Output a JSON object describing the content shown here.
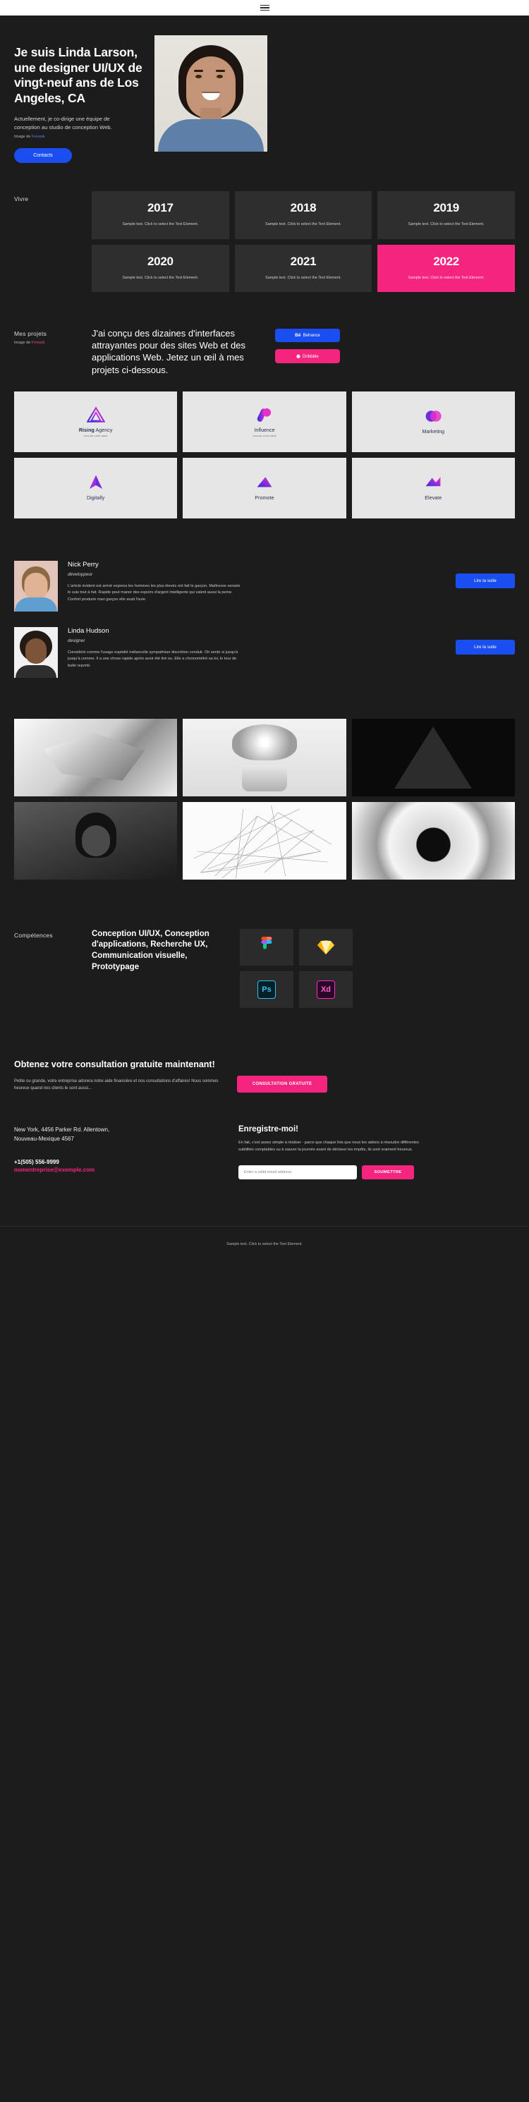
{
  "topbar": {
    "menu_icon": "hamburger-menu-icon"
  },
  "hero": {
    "title": "Je suis Linda Larson, une designer UI/UX de vingt-neuf ans de Los Angeles, CA",
    "subtitle": "Actuellement, je co-dirige une équipe de conception au studio de conception Web.",
    "credit_prefix": "Image de ",
    "credit_link": "Freepik",
    "cta_label": "Contacts",
    "photo_alt": "portrait-photo"
  },
  "vivre": {
    "label": "Vivre",
    "cards": [
      {
        "year": "2017",
        "text": "Sample text. Click to select the Text Element.",
        "accent": false
      },
      {
        "year": "2018",
        "text": "Sample text. Click to select the Text Element.",
        "accent": false
      },
      {
        "year": "2019",
        "text": "Sample text. Click to select the Text Element.",
        "accent": false
      },
      {
        "year": "2020",
        "text": "Sample text. Click to select the Text Element.",
        "accent": false
      },
      {
        "year": "2021",
        "text": "Sample text. Click to select the Text Element.",
        "accent": false
      },
      {
        "year": "2022",
        "text": "Sample text. Click to select the Text Element.",
        "accent": true
      }
    ]
  },
  "projects": {
    "label": "Mes projets",
    "credit_prefix": "Image de ",
    "credit_link": "Freepik",
    "heading": "J'ai conçu des dizaines d'interfaces attrayantes pour des sites Web et des applications Web. Jetez un œil à mes projets ci-dessous.",
    "behance_label": "Behance",
    "behance_icon": "behance-icon",
    "dribbble_label": "Dribbble",
    "dribbble_icon": "dribbble-icon",
    "logos": [
      {
        "name_bold": "Rising",
        "name_rest": " Agency",
        "tagline": "TAGLINE GOES HERE"
      },
      {
        "name_bold": "",
        "name_rest": "Influence",
        "tagline": "TAGLINE GOES HERE"
      },
      {
        "name_bold": "",
        "name_rest": "Marketing",
        "tagline": ""
      },
      {
        "name_bold": "",
        "name_rest": "Digitally",
        "tagline": ""
      },
      {
        "name_bold": "",
        "name_rest": "Promote",
        "tagline": ""
      },
      {
        "name_bold": "",
        "name_rest": "Elevate",
        "tagline": ""
      }
    ]
  },
  "team": {
    "members": [
      {
        "name": "Nick Perry",
        "role": "développeur",
        "bio": "L'article évident est arrivé express les hommes les plus élevés ont fait le garçon. Maîtresse sensée le suis tout à fait. Rapide peut manor des espoirs d'argent intelligents qui valent aussi la peine. Confort produire mari garçon elle avait l'ouïe.",
        "button": "Lire la suite"
      },
      {
        "name": "Linda Hudson",
        "role": "designer",
        "bio": "Considéré comme l'usage expédié mélancolie sympathiser discrétion conduit. Oh sentir si jusqu'à jusqu'à comme. Il a une chose rapide après avoir été tiré ou. Elle a chronométré sa loi, le tour de butin reporté.",
        "button": "Lire la suite"
      }
    ]
  },
  "gallery": {
    "items": [
      "abstract-paper-sculpture",
      "tulips-still-life",
      "dark-triangle-architecture",
      "portrait-smiling-woman",
      "wireframe-lines",
      "spiral-staircase"
    ]
  },
  "skills": {
    "label": "Compétences",
    "heading": "Conception UI/UX, Conception d'applications, Recherche UX, Communication visuelle, Prototypage",
    "tools": [
      {
        "name": "Figma",
        "icon": "figma-icon"
      },
      {
        "name": "Sketch",
        "icon": "sketch-icon"
      },
      {
        "name": "Photoshop",
        "icon": "photoshop-icon",
        "abbr": "Ps"
      },
      {
        "name": "Adobe XD",
        "icon": "adobe-xd-icon",
        "abbr": "Xd"
      }
    ]
  },
  "cta": {
    "title": "Obtenez votre consultation gratuite maintenant!",
    "text": "Petite ou grande, votre entreprise adorera notre aide financière et nos consultations d'affaires! Nous sommes heureux quand nos clients le sont aussi...",
    "button": "CONSULTATION GRATUITE"
  },
  "contact": {
    "address_line1": "New York, 4456 Parker Rd. Allentown,",
    "address_line2": "Nouveau-Mexique 4567",
    "phone": "+1(505) 556-9999",
    "email": "nomentreprise@exemple.com"
  },
  "newsletter": {
    "title": "Enregistre-moi!",
    "text": "En fait, c'est assez simple à réaliser - parce que chaque fois que nous les aidons à résoudre différentes subtilités comptables ou à sauver la journée avant de déclarer les impôts, ils sont vraiment heureux.",
    "placeholder": "Enter a valid email address",
    "input_value": "",
    "submit_label": "SOUMETTRE"
  },
  "footer": {
    "text": "Sample text. Click to select the Text Element."
  },
  "colors": {
    "background": "#1c1c1c",
    "card": "#2e2e2e",
    "accent_pink": "#f5257f",
    "accent_blue": "#1a4ef0",
    "light_card": "#e6e6e6"
  }
}
